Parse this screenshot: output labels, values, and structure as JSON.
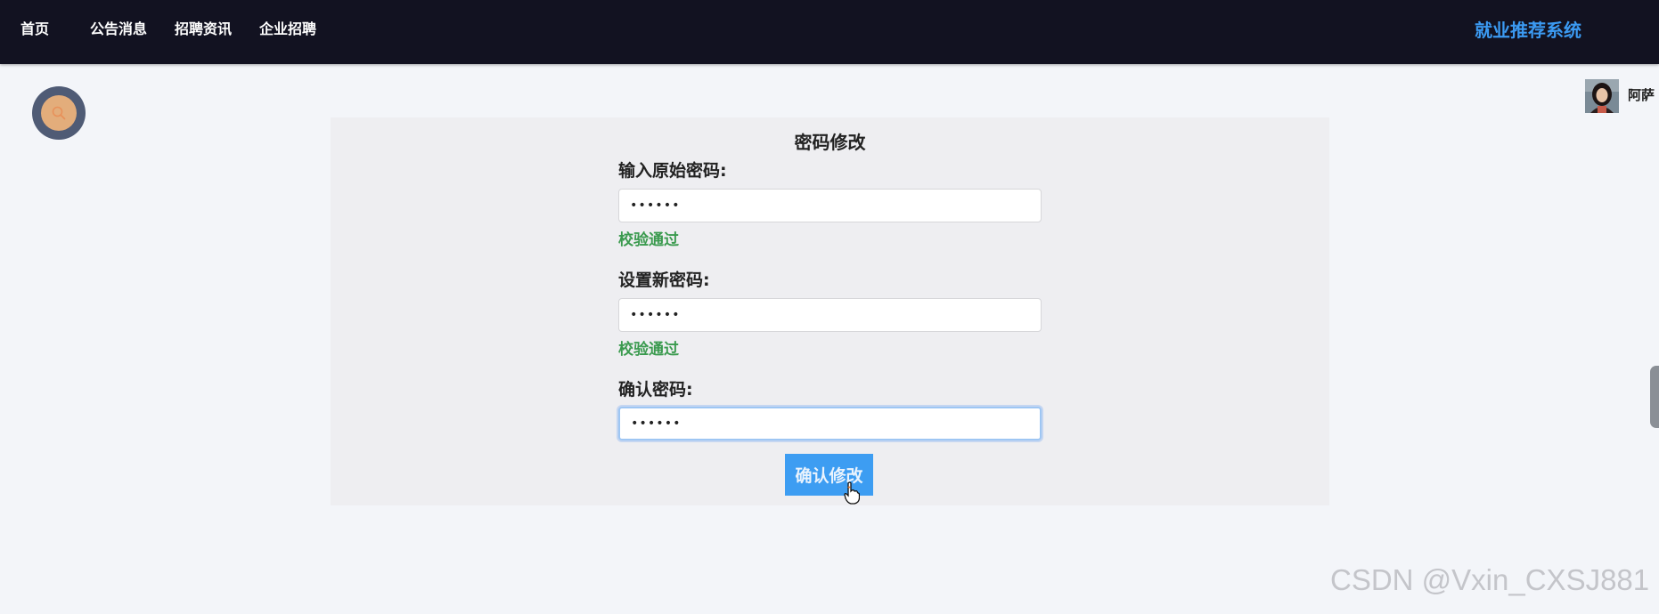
{
  "nav": {
    "items": [
      {
        "label": "首页"
      },
      {
        "label": "公告消息"
      },
      {
        "label": "招聘资讯"
      },
      {
        "label": "企业招聘"
      }
    ],
    "brand": "就业推荐系统"
  },
  "user": {
    "name": "阿萨",
    "avatar_icon": "user-avatar-photo"
  },
  "search_fab": {
    "icon": "search-icon"
  },
  "form": {
    "title": "密码修改",
    "fields": [
      {
        "label": "输入原始密码:",
        "value": "123456",
        "status": "校验通过"
      },
      {
        "label": "设置新密码:",
        "value": "123456",
        "status": "校验通过"
      },
      {
        "label": "确认密码:",
        "value": "123456"
      }
    ],
    "submit_label": "确认修改"
  },
  "watermark": "CSDN @Vxin_CXSJ881",
  "colors": {
    "topbar": "#121221",
    "brand": "#3b9af2",
    "valid": "#3a9a4e",
    "button": "#3d9df2",
    "card": "#eeeef1",
    "page": "#f3f5f9"
  }
}
